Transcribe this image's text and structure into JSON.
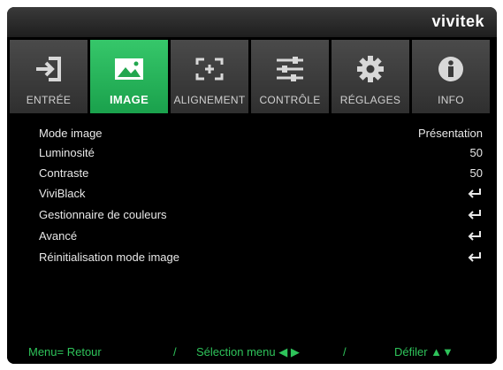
{
  "brand": "vivitek",
  "tabs": [
    {
      "label": "ENTRÉE",
      "icon": "input-icon",
      "active": false
    },
    {
      "label": "IMAGE",
      "icon": "image-icon",
      "active": true
    },
    {
      "label": "ALIGNEMENT",
      "icon": "alignment-icon",
      "active": false
    },
    {
      "label": "CONTRÔLE",
      "icon": "sliders-icon",
      "active": false
    },
    {
      "label": "RÉGLAGES",
      "icon": "gear-icon",
      "active": false
    },
    {
      "label": "INFO",
      "icon": "info-icon",
      "active": false
    }
  ],
  "menu": [
    {
      "label": "Mode image",
      "value": "Présentation"
    },
    {
      "label": "Luminosité",
      "value": "50"
    },
    {
      "label": "Contraste",
      "value": "50"
    },
    {
      "label": "ViviBlack",
      "value": "",
      "enter": true
    },
    {
      "label": "Gestionnaire de couleurs",
      "value": "",
      "enter": true
    },
    {
      "label": "Avancé",
      "value": "",
      "enter": true
    },
    {
      "label": "Réinitialisation mode image",
      "value": "",
      "enter": true
    }
  ],
  "footer": {
    "back": "Menu= Retour",
    "sep": "/",
    "select": "Sélection menu ◀ ▶",
    "scroll": "Défiler ▲▼"
  },
  "colors": {
    "accent": "#2ec35a",
    "background": "#000000"
  }
}
